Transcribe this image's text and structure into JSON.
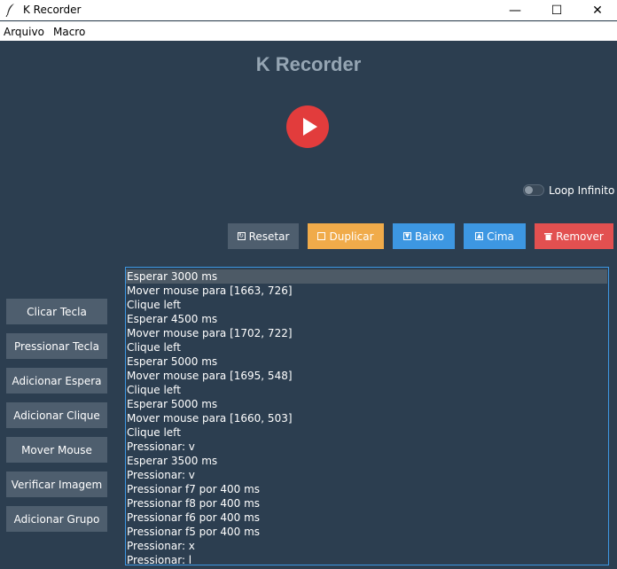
{
  "window": {
    "title": "K Recorder",
    "minimize_glyph": "—",
    "maximize_glyph": "☐",
    "close_glyph": "✕"
  },
  "menu": {
    "items": [
      "Arquivo",
      "Macro"
    ]
  },
  "header": {
    "title": "K Recorder"
  },
  "loop": {
    "label": "Loop Infinito",
    "enabled": false
  },
  "toolbar": {
    "reset": "Resetar",
    "duplicate": "Duplicar",
    "down": "Baixo",
    "up": "Cima",
    "remove": "Remover"
  },
  "sidebar": {
    "buttons": [
      "Clicar Tecla",
      "Pressionar Tecla",
      "Adicionar Espera",
      "Adicionar Clique",
      "Mover Mouse",
      "Verificar Imagem",
      "Adicionar Grupo"
    ]
  },
  "actions": {
    "selected_index": 0,
    "items": [
      "Esperar 3000 ms",
      "Mover mouse para [1663, 726]",
      "Clique left",
      "Esperar 4500 ms",
      "Mover mouse para [1702, 722]",
      "Clique left",
      "Esperar 5000 ms",
      "Mover mouse para [1695, 548]",
      "Clique left",
      "Esperar 5000 ms",
      "Mover mouse para [1660, 503]",
      "Clique left",
      "Pressionar: v",
      "Esperar 3500 ms",
      "Pressionar: v",
      "Pressionar f7 por 400 ms",
      "Pressionar f8 por 400 ms",
      "Pressionar f6 por 400 ms",
      "Pressionar f5 por 400 ms",
      "Pressionar: x",
      "Pressionar: l"
    ]
  },
  "colors": {
    "background": "#2c3e50",
    "play": "#e23c3c",
    "duplicate": "#f0ab4a",
    "move": "#3d97e2",
    "remove": "#e25050",
    "neutral": "#4e5e6e"
  }
}
